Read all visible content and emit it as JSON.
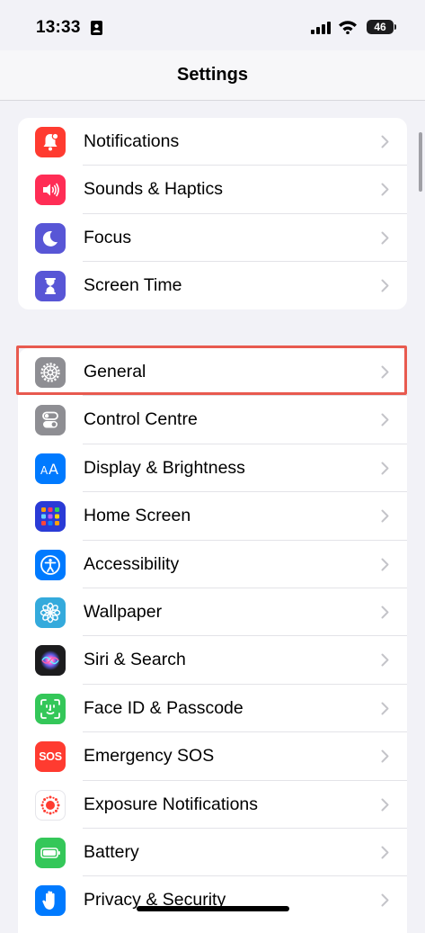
{
  "status_bar": {
    "time": "13:33",
    "battery": "46"
  },
  "nav": {
    "title": "Settings"
  },
  "groups": [
    {
      "items": [
        {
          "label": "Notifications",
          "icon": "bell-icon",
          "color": "#ff3b30"
        },
        {
          "label": "Sounds & Haptics",
          "icon": "speaker-icon",
          "color": "#ff2d55"
        },
        {
          "label": "Focus",
          "icon": "moon-icon",
          "color": "#5856d6"
        },
        {
          "label": "Screen Time",
          "icon": "hourglass-icon",
          "color": "#5856d6"
        }
      ]
    },
    {
      "items": [
        {
          "label": "General",
          "icon": "gear-icon",
          "color": "#8e8e93",
          "highlighted": true
        },
        {
          "label": "Control Centre",
          "icon": "toggles-icon",
          "color": "#8e8e93"
        },
        {
          "label": "Display & Brightness",
          "icon": "text-size-icon",
          "color": "#007aff"
        },
        {
          "label": "Home Screen",
          "icon": "app-grid-icon",
          "color": "#2a3bd6"
        },
        {
          "label": "Accessibility",
          "icon": "accessibility-icon",
          "color": "#007aff"
        },
        {
          "label": "Wallpaper",
          "icon": "flower-icon",
          "color": "#34aadc"
        },
        {
          "label": "Siri & Search",
          "icon": "siri-icon",
          "color": "#1c1c1e"
        },
        {
          "label": "Face ID & Passcode",
          "icon": "face-id-icon",
          "color": "#34c759"
        },
        {
          "label": "Emergency SOS",
          "icon": "sos-icon",
          "color": "#ff3b30",
          "icon_text": "SOS"
        },
        {
          "label": "Exposure Notifications",
          "icon": "exposure-icon",
          "color": "#ffffff"
        },
        {
          "label": "Battery",
          "icon": "battery-icon",
          "color": "#34c759"
        },
        {
          "label": "Privacy & Security",
          "icon": "hand-icon",
          "color": "#007aff"
        }
      ]
    }
  ]
}
